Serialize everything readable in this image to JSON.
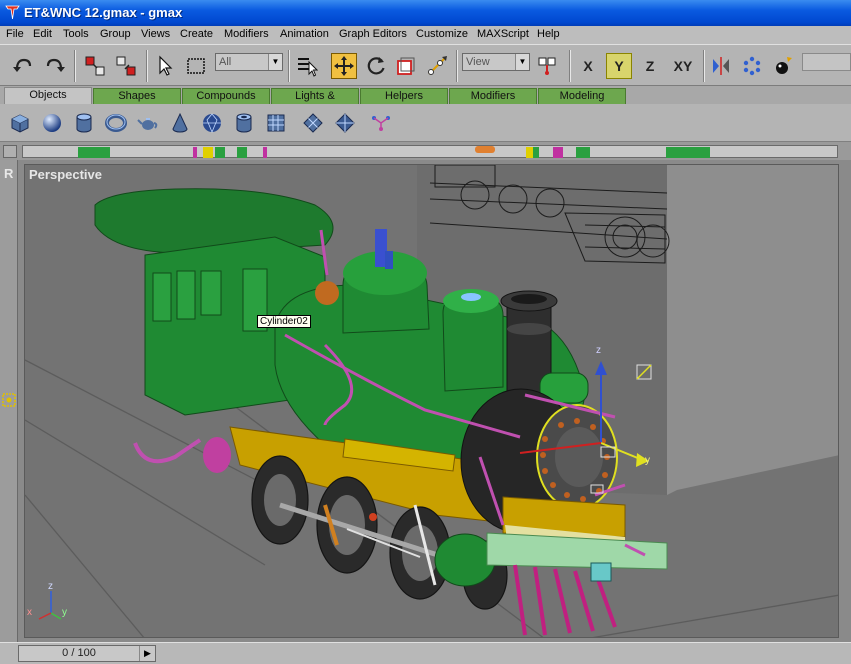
{
  "window": {
    "title": "ET&WNC 12.gmax - gmax"
  },
  "menu": [
    "File",
    "Edit",
    "Tools",
    "Group",
    "Views",
    "Create",
    "Modifiers",
    "Animation",
    "Graph Editors",
    "Customize",
    "MAXScript",
    "Help"
  ],
  "toolbar": {
    "selection_filter": "All",
    "reference_coord": "View",
    "axis_labels": {
      "x": "X",
      "y": "Y",
      "z": "Z",
      "xy": "XY"
    },
    "active_axis": "Y"
  },
  "command_tabs": [
    "Objects",
    "Shapes",
    "Compounds",
    "Lights & Cameras",
    "Helpers",
    "Modifiers",
    "Modeling"
  ],
  "active_tab": "Objects",
  "create_icons": [
    "box-icon",
    "sphere-icon",
    "cylinder-icon",
    "torus-icon",
    "teapot-icon",
    "cone-icon",
    "geosphere-icon",
    "tube-icon",
    "plane-icon",
    "grid-object-icon",
    "dummy-icon",
    "bones-icon"
  ],
  "viewport": {
    "side_label": "R",
    "label": "Perspective",
    "tooltip": "Cylinder02",
    "gizmo_axes": {
      "x": "x",
      "y": "y",
      "z": "z"
    }
  },
  "statusbar": {
    "time_slider": "0 / 100"
  },
  "colors": {
    "title_blue": "#0a5ae0",
    "tab_green": "#6da74e",
    "active_orange": "#f0c040",
    "loco_green": "#1f8a33",
    "loco_black": "#1e1e1e",
    "loco_magenta": "#c040a0"
  }
}
